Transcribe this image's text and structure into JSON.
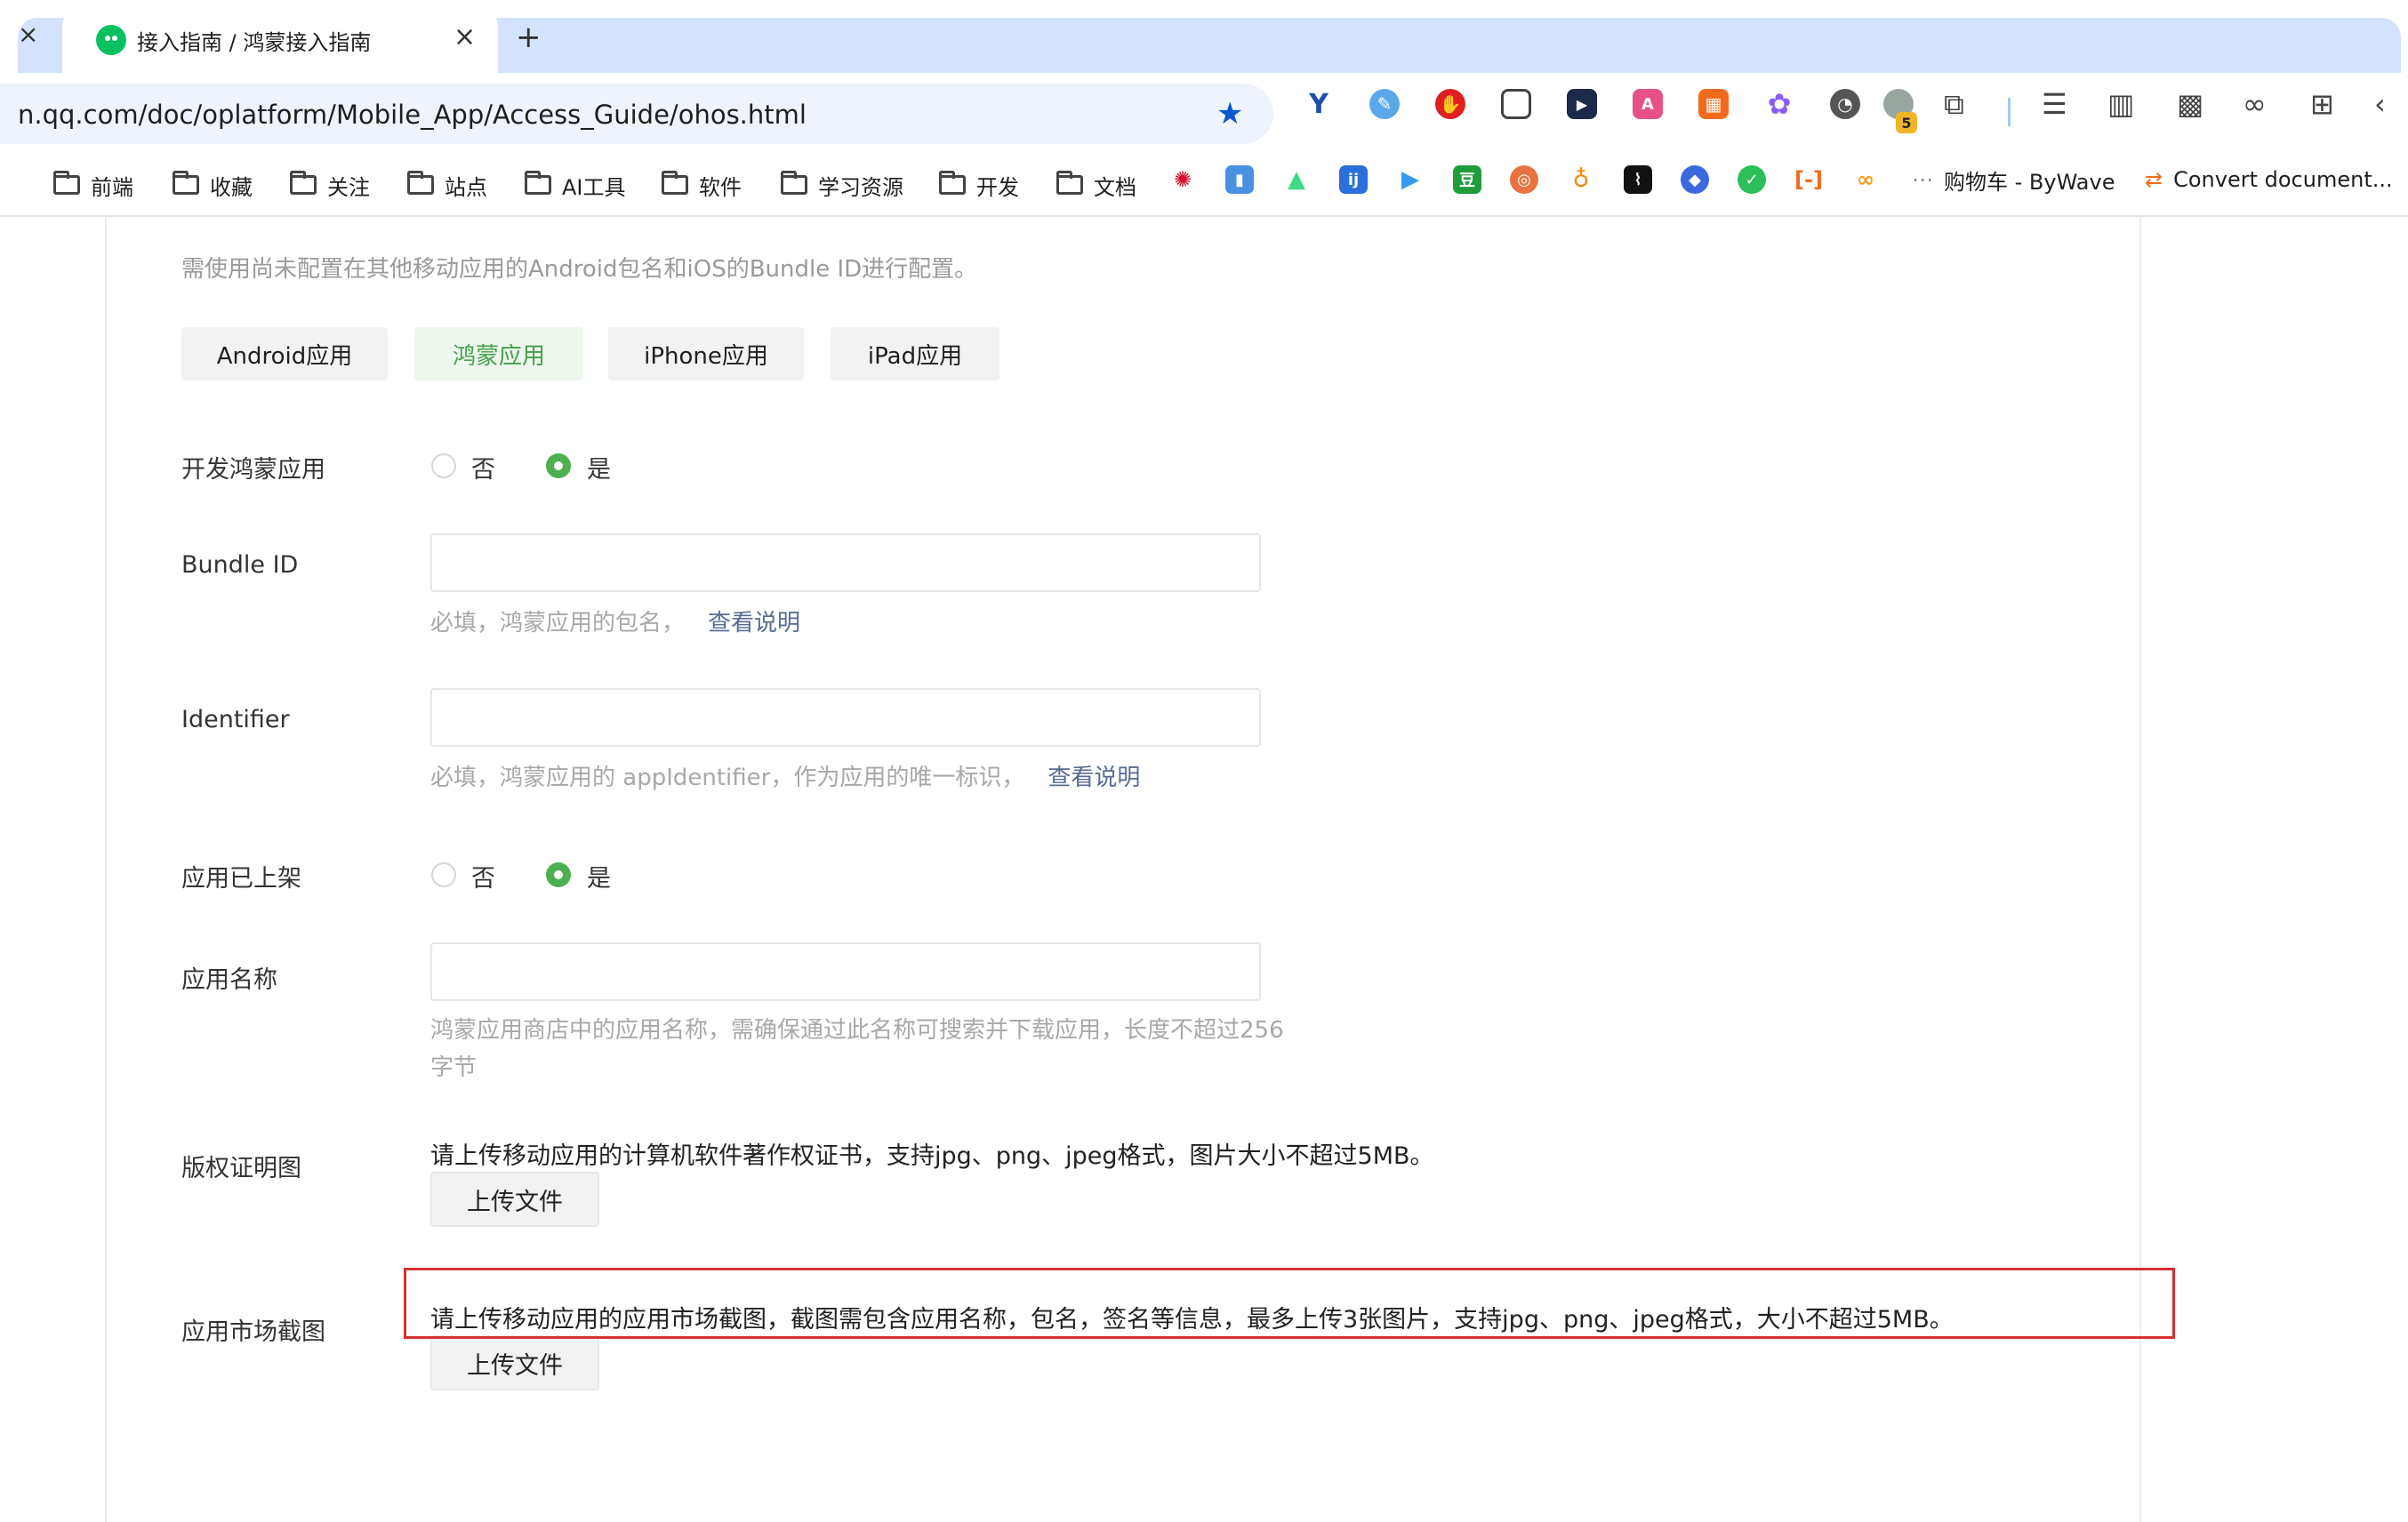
{
  "browser": {
    "tab_title": "接入指南 / 鸿蒙接入指南",
    "close_glyph": "×",
    "new_tab_glyph": "+",
    "url": "n.qq.com/doc/oplatform/Mobile_App/Access_Guide/ohos.html",
    "star_glyph": "★",
    "extension_badge": "5",
    "bookmarks": [
      {
        "label": "前端"
      },
      {
        "label": "收藏"
      },
      {
        "label": "关注"
      },
      {
        "label": "站点"
      },
      {
        "label": "AI工具"
      },
      {
        "label": "软件"
      },
      {
        "label": "学习资源"
      },
      {
        "label": "开发"
      },
      {
        "label": "文档"
      }
    ],
    "bookmark_shop": "购物车 - ByWave",
    "bookmark_convert": "Convert document..."
  },
  "page": {
    "intro": "需使用尚未配置在其他移动应用的Android包名和iOS的Bundle ID进行配置。",
    "platform_tabs": [
      "Android应用",
      "鸿蒙应用",
      "iPhone应用",
      "iPad应用"
    ],
    "develop_label": "开发鸿蒙应用",
    "no_label": "否",
    "yes_label": "是",
    "bundle_label": "Bundle ID",
    "bundle_help": "必填，鸿蒙应用的包名，",
    "see_desc": "查看说明",
    "identifier_label": "Identifier",
    "identifier_help": "必填，鸿蒙应用的 appIdentifier，作为应用的唯一标识，",
    "listed_label": "应用已上架",
    "appname_label": "应用名称",
    "appname_help_1": "鸿蒙应用商店中的应用名称，需确保通过此名称可搜索并下载应用，长度不超过256",
    "appname_help_2": "字节",
    "copyright_label": "版权证明图",
    "copyright_desc": "请上传移动应用的计算机软件著作权证书，支持jpg、png、jpeg格式，图片大小不超过5MB。",
    "upload_label": "上传文件",
    "screenshot_label": "应用市场截图",
    "screenshot_desc": "请上传移动应用的应用市场截图，截图需包含应用名称，包名，签名等信息，最多上传3张图片，支持jpg、png、jpeg格式，大小不超过5MB。"
  },
  "colors": {
    "accent_green": "#4caf50",
    "link": "#576b95",
    "highlight_red": "#d63030",
    "tab_strip": "#d3e3fd"
  }
}
